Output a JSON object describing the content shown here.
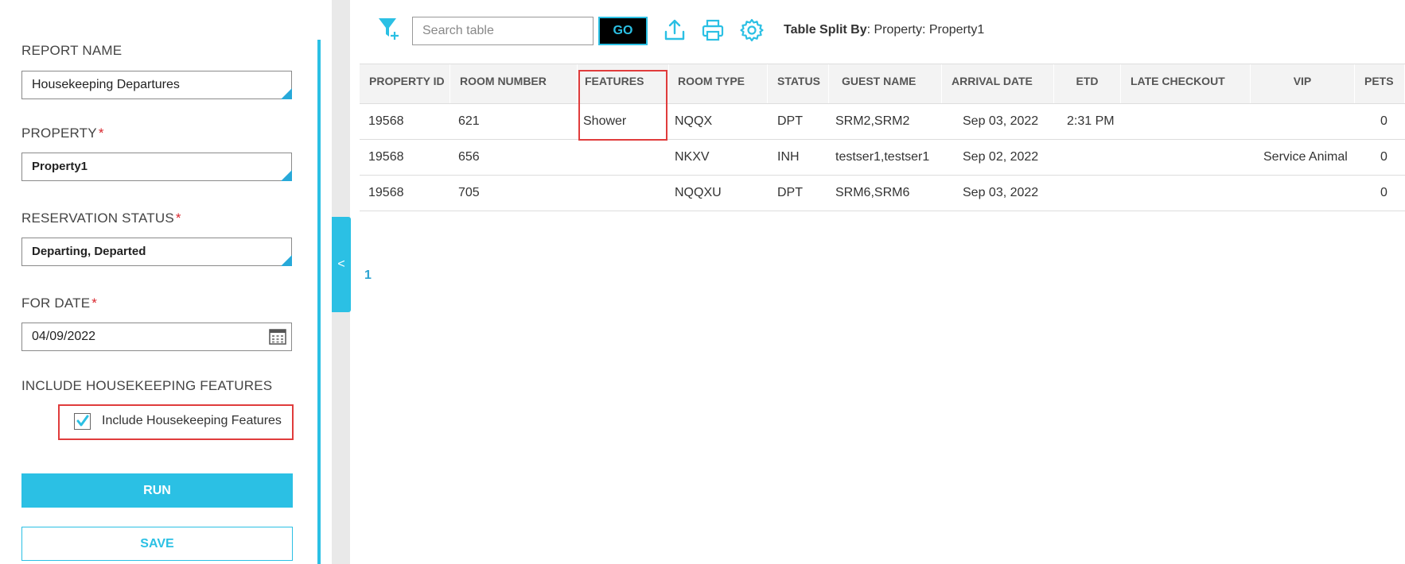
{
  "form": {
    "report_name_label": "REPORT NAME",
    "report_name_value": "Housekeeping Departures",
    "property_label": "PROPERTY",
    "property_value": "Property1",
    "reservation_status_label": "RESERVATION STATUS",
    "reservation_status_value": "Departing, Departed",
    "for_date_label": "FOR DATE",
    "for_date_value": "04/09/2022",
    "include_section_label": "INCLUDE HOUSEKEEPING FEATURES",
    "include_checkbox_label": "Include Housekeeping Features",
    "include_checked": true,
    "required_marker": "*",
    "run_label": "RUN",
    "save_label": "SAVE"
  },
  "sidebar_toggle_label": "<",
  "toolbar": {
    "search_placeholder": "Search table",
    "go_label": "GO",
    "split_label": "Table Split By",
    "split_value": ": Property: Property1",
    "icons": [
      "filter-add-icon",
      "export-icon",
      "print-icon",
      "gear-icon"
    ]
  },
  "table": {
    "headers": [
      "PROPERTY ID",
      "ROOM NUMBER",
      "FEATURES",
      "ROOM TYPE",
      "STATUS",
      "GUEST NAME",
      "ARRIVAL DATE",
      "ETD",
      "LATE CHECKOUT",
      "VIP",
      "PETS"
    ],
    "rows": [
      [
        "19568",
        "621",
        "Shower",
        "NQQX",
        "DPT",
        "SRM2,SRM2",
        "Sep 03, 2022",
        "2:31 PM",
        "",
        "",
        "0"
      ],
      [
        "19568",
        "656",
        "",
        "NKXV",
        "INH",
        "testser1,testser1",
        "Sep 02, 2022",
        "",
        "",
        "Service Animal",
        "0"
      ],
      [
        "19568",
        "705",
        "",
        "NQQXU",
        "DPT",
        "SRM6,SRM6",
        "Sep 03, 2022",
        "",
        "",
        "",
        "0"
      ]
    ]
  },
  "pagination": {
    "current_page": "1"
  },
  "colors": {
    "accent": "#2bc0e4",
    "highlight": "#e03c3c",
    "required": "#d9262d"
  }
}
